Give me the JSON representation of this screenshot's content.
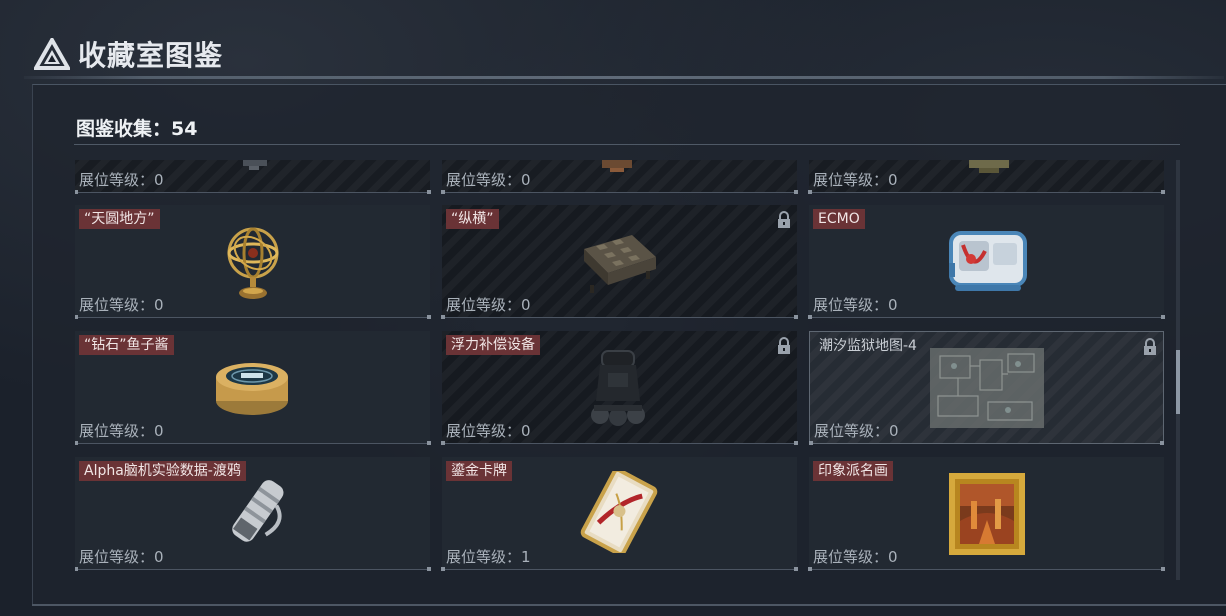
{
  "header": {
    "tiny_text": "",
    "title": "收藏室图鉴"
  },
  "collection": {
    "label": "图鉴收集：",
    "count": "54",
    "full": "图鉴收集：54"
  },
  "level_prefix": "展位等级：",
  "top_row": [
    {
      "level": "展位等级：0"
    },
    {
      "level": "展位等级：0"
    },
    {
      "level": "展位等级：0"
    }
  ],
  "items": [
    {
      "name": "“天圆地方”",
      "level": "展位等级：0",
      "locked": false,
      "icon": "armillary-sphere-icon"
    },
    {
      "name": "“纵横”",
      "level": "展位等级：0",
      "locked": true,
      "icon": "chessboard-icon"
    },
    {
      "name": "ECMO",
      "level": "展位等级：0",
      "locked": false,
      "icon": "ecmo-machine-icon"
    },
    {
      "name": "“钻石”鱼子酱",
      "level": "展位等级：0",
      "locked": false,
      "icon": "caviar-tin-icon"
    },
    {
      "name": "浮力补偿设备",
      "level": "展位等级：0",
      "locked": true,
      "icon": "buoyancy-device-icon"
    },
    {
      "name": "潮汐监狱地图-4",
      "level": "展位等级：0",
      "locked": true,
      "icon": "prison-map-icon"
    },
    {
      "name": "Alpha脑机实验数据-渡鸦",
      "level": "展位等级：0",
      "locked": false,
      "icon": "data-canister-icon"
    },
    {
      "name": "鎏金卡牌",
      "level": "展位等级：1",
      "locked": false,
      "icon": "gilded-card-icon"
    },
    {
      "name": "印象派名画",
      "level": "展位等级：0",
      "locked": false,
      "icon": "framed-painting-icon"
    }
  ],
  "colors": {
    "name_tag": "#6a3336",
    "accent_gold": "#c9a24a",
    "scroll_thumb": "#8d98a5"
  }
}
